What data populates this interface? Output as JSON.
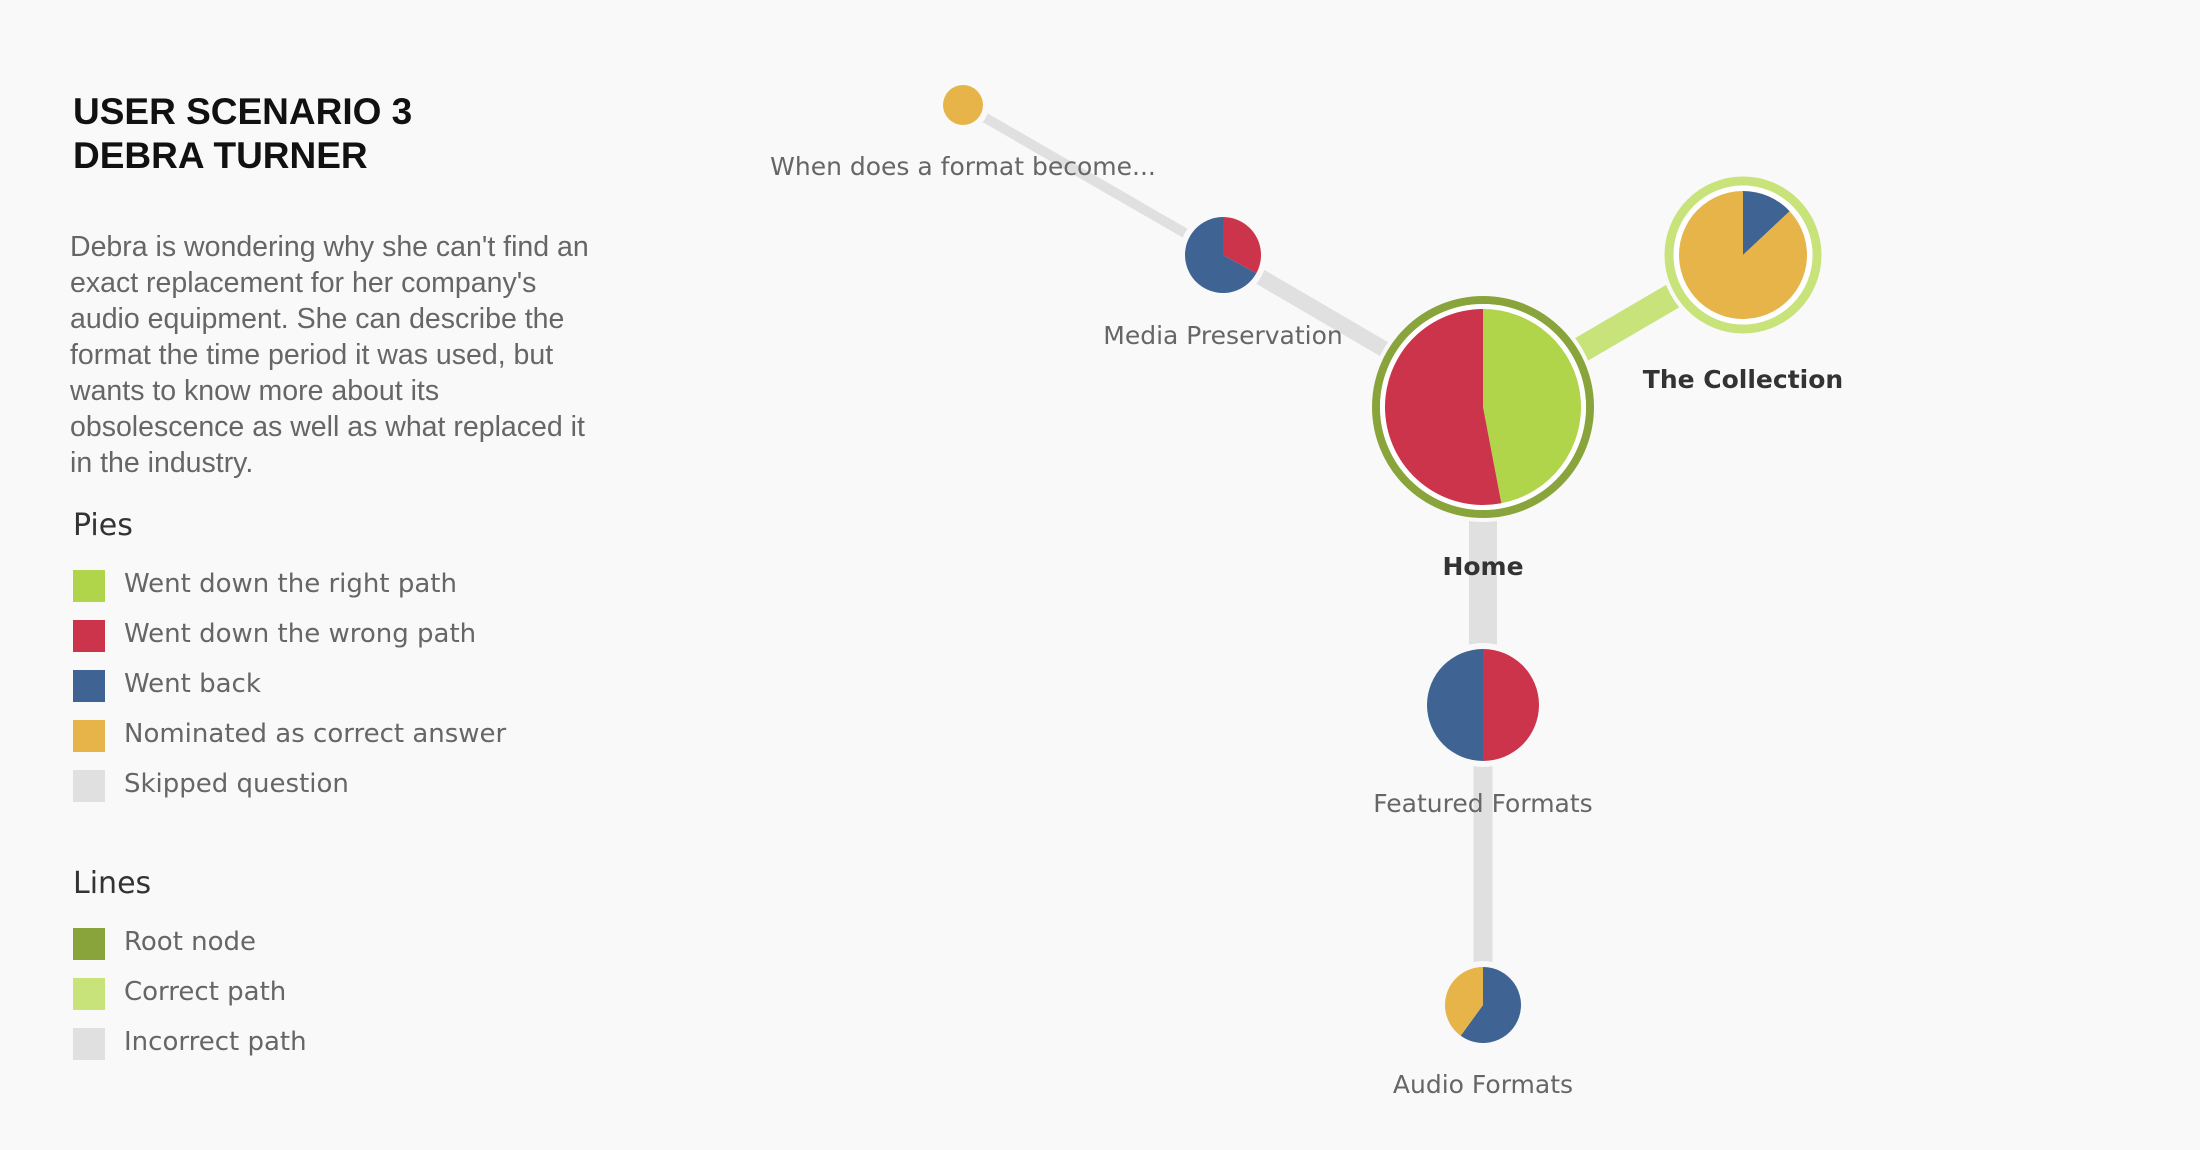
{
  "title_line1": "USER SCENARIO 3",
  "title_line2": "DEBRA TURNER",
  "description": "Debra is wondering why she can't find an exact replacement for her company's audio equipment. She can describe the format the time period it was used, but wants to know more about its obsolescence as well as what replaced it in the industry.",
  "pies_title": "Pies",
  "pies_legend": [
    {
      "label": "Went down the right path",
      "color": "#b0d44a"
    },
    {
      "label": "Went down the wrong path",
      "color": "#cc344b"
    },
    {
      "label": "Went back",
      "color": "#3f6494"
    },
    {
      "label": "Nominated as correct answer",
      "color": "#e6b448"
    },
    {
      "label": "Skipped question",
      "color": "#e0e0e0"
    }
  ],
  "lines_title": "Lines",
  "lines_legend": [
    {
      "label": "Root node",
      "color": "#8aa43c"
    },
    {
      "label": "Correct path",
      "color": "#c7e37a"
    },
    {
      "label": "Incorrect path",
      "color": "#e0e0e0"
    }
  ],
  "nodes": [
    {
      "id": "home",
      "label": "Home",
      "ring": "root",
      "label_style": "strong",
      "slices": [
        {
          "status": "right",
          "value": 0.47
        },
        {
          "status": "wrong",
          "value": 0.53
        }
      ]
    },
    {
      "id": "collection",
      "label": "The Collection",
      "ring": "correct",
      "label_style": "strong",
      "slices": [
        {
          "status": "back",
          "value": 0.13
        },
        {
          "status": "nominated",
          "value": 0.87
        }
      ]
    },
    {
      "id": "media",
      "label": "Media Preservation",
      "ring": null,
      "label_style": "normal",
      "slices": [
        {
          "status": "wrong",
          "value": 0.33
        },
        {
          "status": "back",
          "value": 0.67
        }
      ]
    },
    {
      "id": "when",
      "label": "When does a format become...",
      "ring": null,
      "label_style": "normal",
      "slices": [
        {
          "status": "nominated",
          "value": 1.0
        }
      ]
    },
    {
      "id": "featured",
      "label": "Featured Formats",
      "ring": null,
      "label_style": "normal",
      "slices": [
        {
          "status": "wrong",
          "value": 0.5
        },
        {
          "status": "back",
          "value": 0.5
        }
      ]
    },
    {
      "id": "audio",
      "label": "Audio Formats",
      "ring": null,
      "label_style": "normal",
      "slices": [
        {
          "status": "back",
          "value": 0.6
        },
        {
          "status": "nominated",
          "value": 0.4
        }
      ]
    }
  ],
  "edges": [
    {
      "from": "home",
      "to": "collection",
      "type": "correct"
    },
    {
      "from": "home",
      "to": "media",
      "type": "incorrect"
    },
    {
      "from": "media",
      "to": "when",
      "type": "incorrect"
    },
    {
      "from": "home",
      "to": "featured",
      "type": "incorrect"
    },
    {
      "from": "featured",
      "to": "audio",
      "type": "incorrect"
    }
  ],
  "colors": {
    "right": "#b0d44a",
    "wrong": "#cc344b",
    "back": "#3f6494",
    "nominated": "#e6b448",
    "skipped": "#e0e0e0",
    "root_ring": "#8aa43c",
    "correct_ring": "#c7e37a",
    "correct_line": "#c7e37a",
    "incorrect_line": "#e0e0e0"
  }
}
